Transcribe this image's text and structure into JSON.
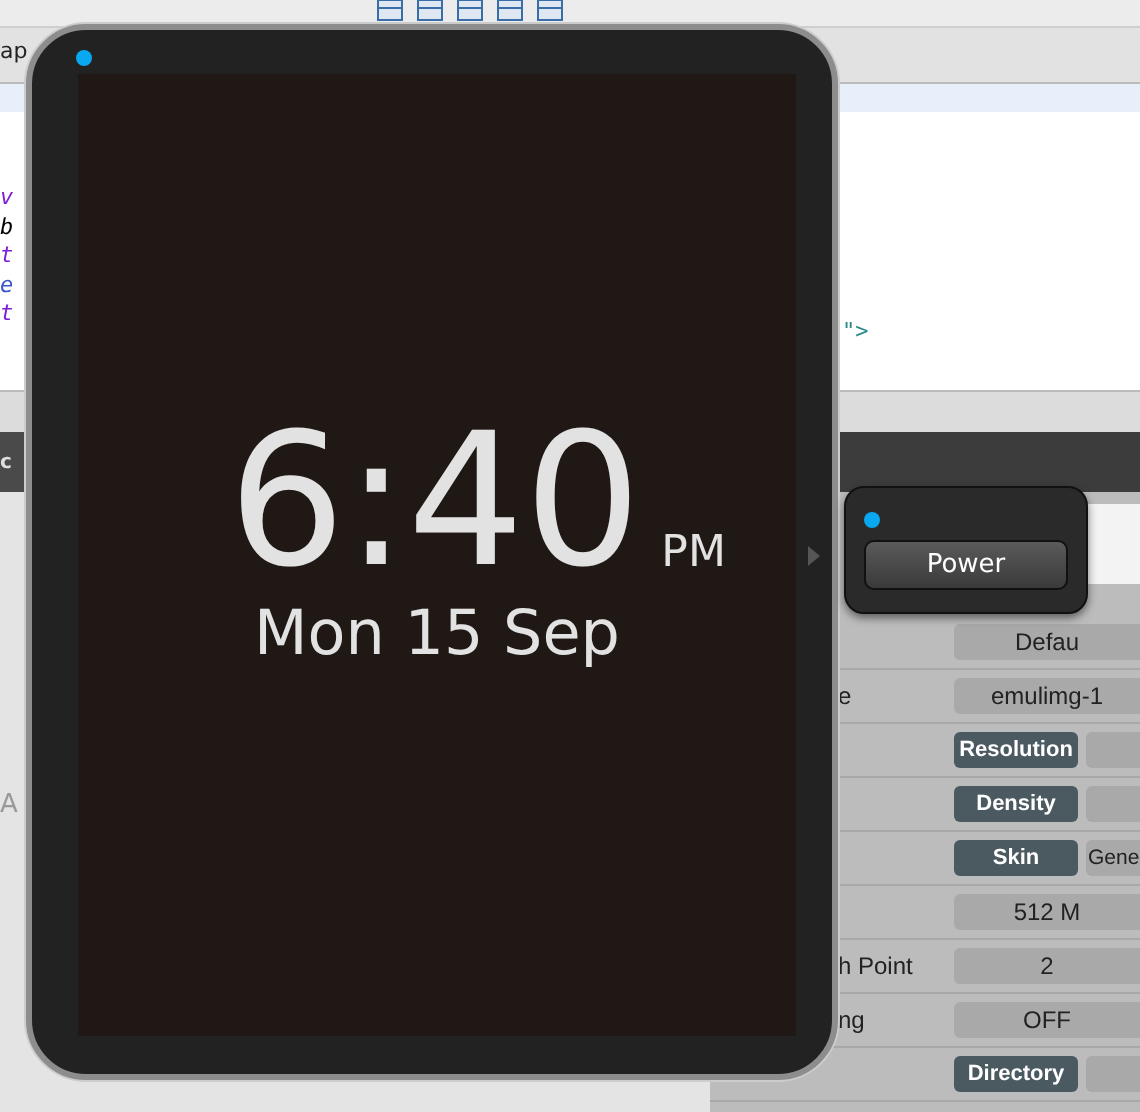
{
  "ide": {
    "editor_tab_fragment": "ap",
    "code_fragments": [
      {
        "text": "v",
        "color": "#7a1fd6"
      },
      {
        "text": "b",
        "color": "#000000"
      },
      {
        "text": "t",
        "color": "#7a1fd6"
      },
      {
        "text": "e",
        "color": "#3a55c8"
      },
      {
        "text": "t",
        "color": "#7a1fd6"
      }
    ],
    "code_fragment_right": "\">",
    "panel_title_fragment": "c",
    "side_fragment": "A"
  },
  "properties": {
    "rows": [
      {
        "kind": "value",
        "value": "Defau"
      },
      {
        "kind": "value",
        "label": "e",
        "value": "emulimg-1"
      },
      {
        "kind": "button",
        "button": "Resolution"
      },
      {
        "kind": "button",
        "button": "Density"
      },
      {
        "kind": "button",
        "button": "Skin",
        "value": "Gene"
      },
      {
        "kind": "value",
        "value": "512 M"
      },
      {
        "kind": "value",
        "label": "h Point",
        "value": "2"
      },
      {
        "kind": "value",
        "label": "ng",
        "value": "OFF"
      },
      {
        "kind": "button",
        "button": "Directory"
      }
    ]
  },
  "emulator": {
    "indicator_on": true,
    "time": "6:40",
    "meridiem": "PM",
    "date": "Mon 15 Sep"
  },
  "power_panel": {
    "indicator_on": true,
    "button": "Power"
  }
}
